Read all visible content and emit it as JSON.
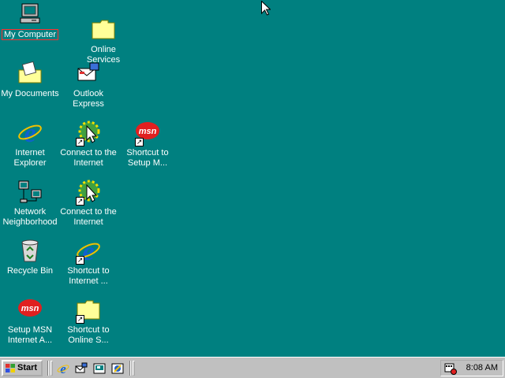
{
  "desktop": {
    "background": "#008080",
    "icons": [
      {
        "label": "My Computer",
        "icon": "my-computer-icon",
        "selected": true
      },
      {
        "label": "Online Services",
        "icon": "folder-icon"
      },
      {
        "label": "My Documents",
        "icon": "my-documents-icon"
      },
      {
        "label": "Outlook Express",
        "icon": "outlook-express-icon"
      },
      {
        "label": "Internet Explorer",
        "icon": "internet-explorer-icon"
      },
      {
        "label": "Connect to the Internet",
        "icon": "connect-internet-icon",
        "shortcut": true
      },
      {
        "label": "Shortcut to Setup M...",
        "icon": "msn-icon",
        "shortcut": true
      },
      {
        "label": "Network Neighborhood",
        "icon": "network-icon"
      },
      {
        "label": "Connect to the Internet",
        "icon": "connect-internet-icon",
        "shortcut": true
      },
      {
        "label": "Recycle Bin",
        "icon": "recycle-bin-icon"
      },
      {
        "label": "Shortcut to Internet ...",
        "icon": "internet-explorer-icon",
        "shortcut": true
      },
      {
        "label": "Setup MSN Internet A...",
        "icon": "msn-icon"
      },
      {
        "label": "Shortcut to Online S...",
        "icon": "folder-icon",
        "shortcut": true
      }
    ]
  },
  "taskbar": {
    "start_label": "Start",
    "quick_launch": [
      "internet-explorer-icon",
      "outlook-express-icon",
      "show-desktop-icon",
      "channels-icon"
    ],
    "clock": "8:08 AM"
  }
}
